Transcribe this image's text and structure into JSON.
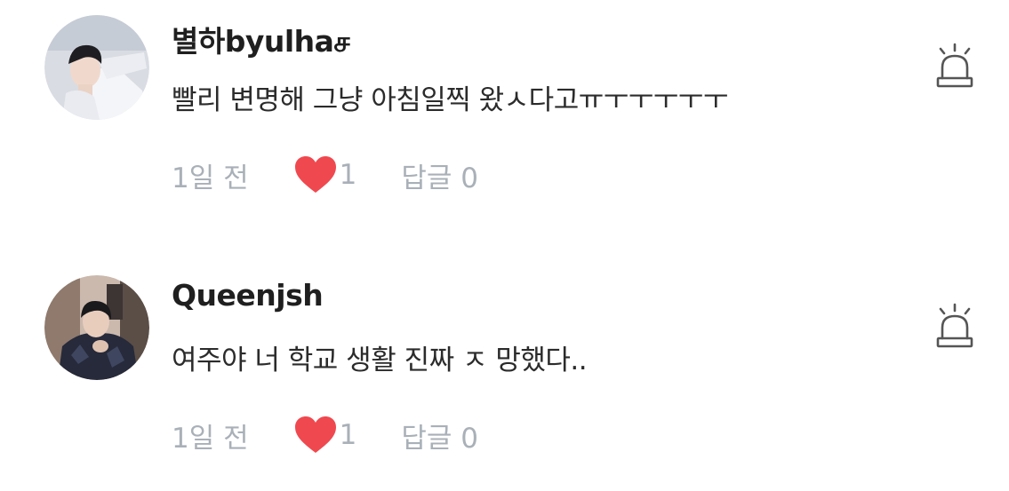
{
  "comments": [
    {
      "username": "별하byulhaச",
      "text": "빨리 변명해 그냥 아침일찍 왔ㅅ다고ㅠㅜㅜㅜㅜㅜ",
      "time": "1일 전",
      "likes": "1",
      "reply": "답글 0",
      "avatar_icon": "profile-photo"
    },
    {
      "username": "Queenjsh",
      "text": "여주야 너 학교 생활 진짜 ㅈ 망했다..",
      "time": "1일 전",
      "likes": "1",
      "reply": "답글 0",
      "avatar_icon": "profile-photo"
    }
  ],
  "icons": {
    "like": "heart-icon",
    "report": "siren-icon"
  },
  "colors": {
    "heart": "#f0484f",
    "meta_text": "#a9b0b8",
    "username": "#1f1f1f",
    "body_text": "#2b2b2b",
    "report_icon": "#555555"
  }
}
